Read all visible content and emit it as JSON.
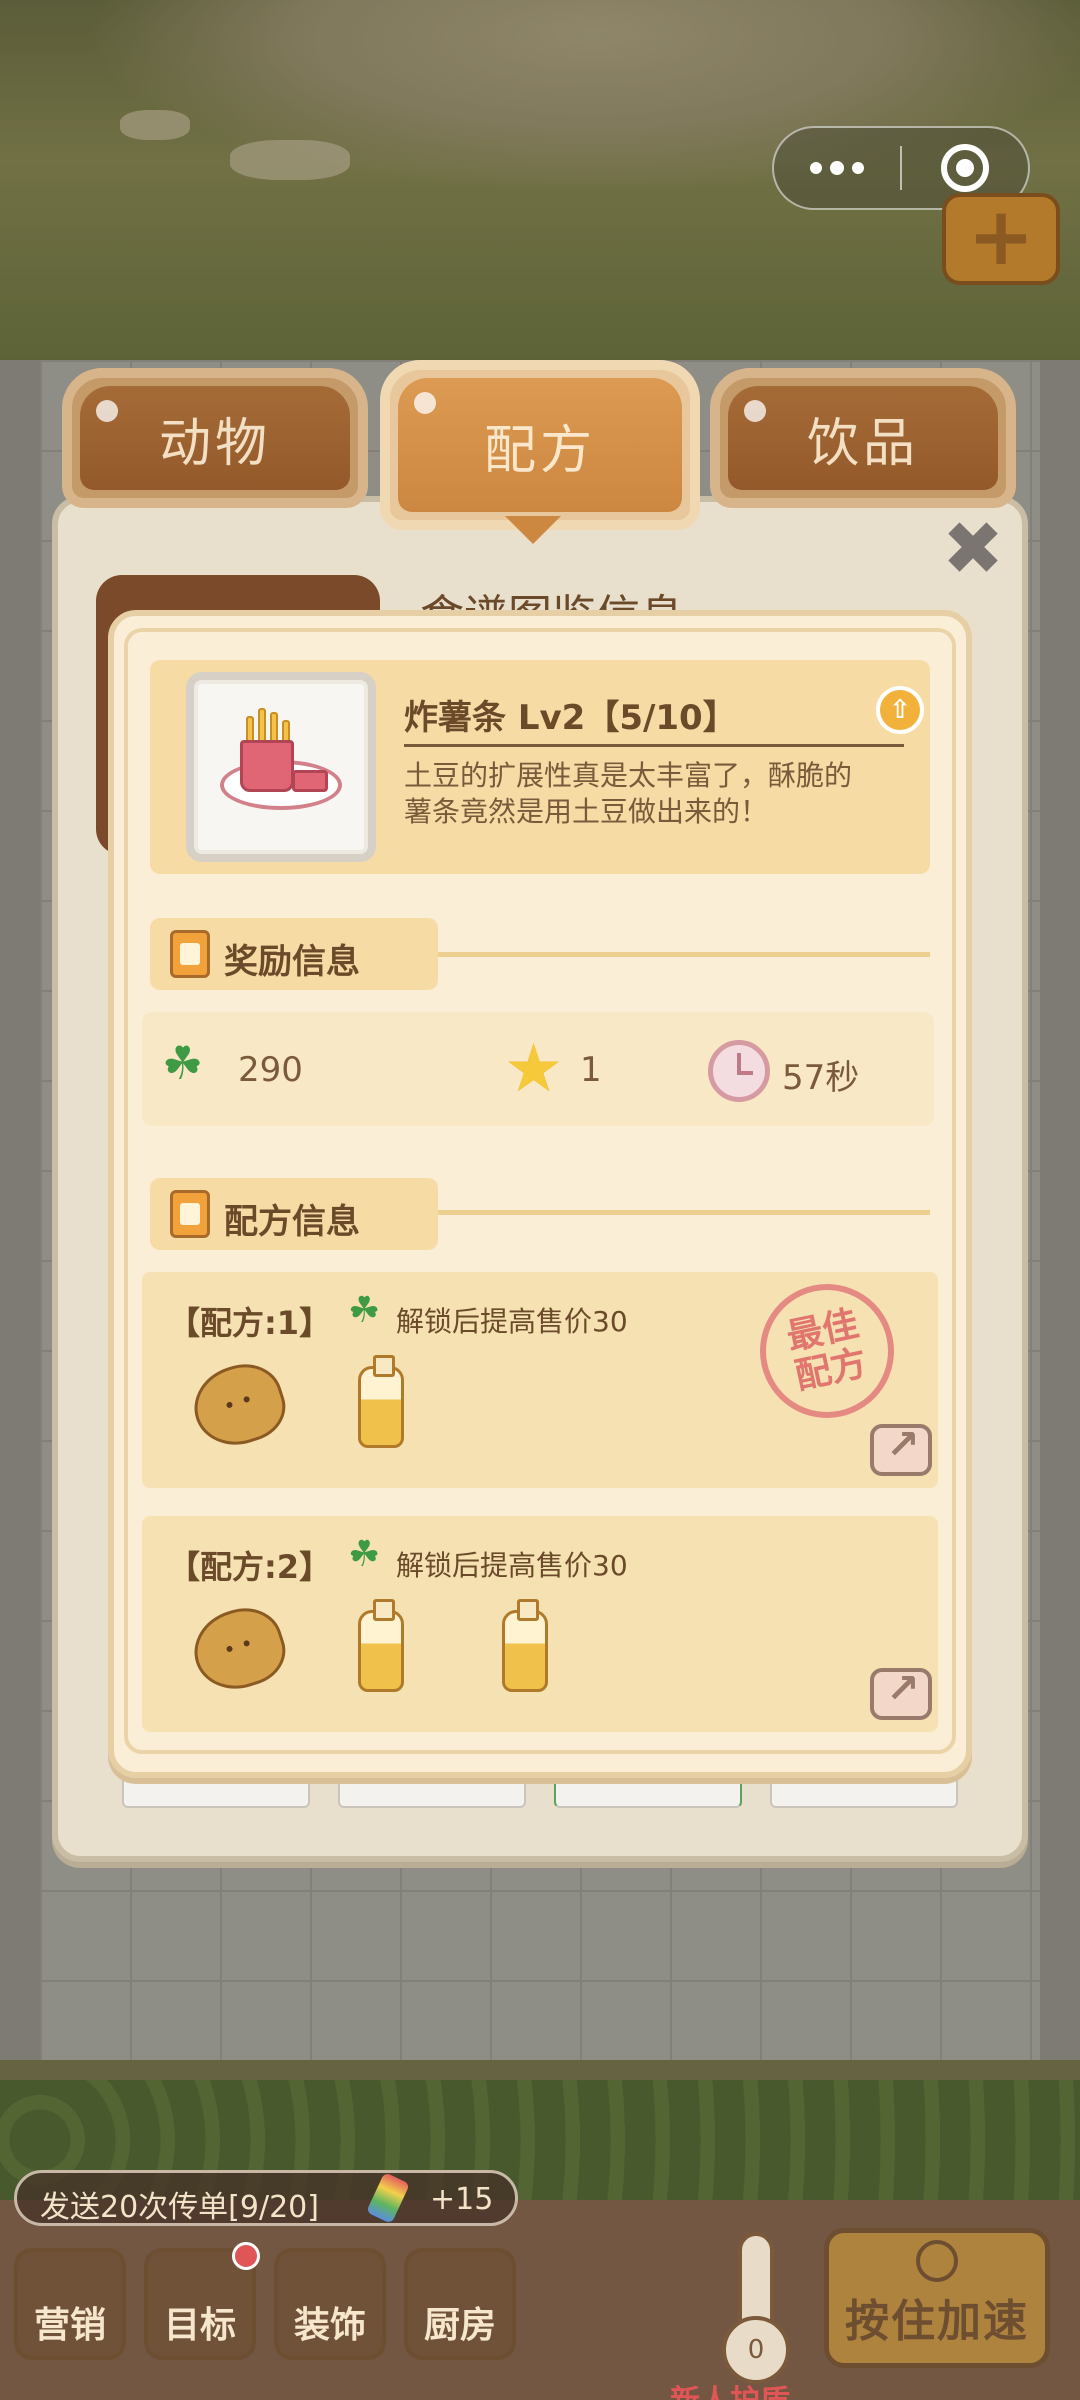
{
  "tabs": [
    {
      "label": "动物"
    },
    {
      "label": "配方"
    },
    {
      "label": "饮品"
    }
  ],
  "panel": {
    "background_title": "食谱图鉴信息"
  },
  "item": {
    "name": "炸薯条 Lv2【5/10】",
    "description": "土豆的扩展性真是太丰富了，酥脆的薯条竟然是用土豆做出来的！",
    "image_icon": "fries-icon",
    "upgrade_icon": "arrow-up-icon"
  },
  "rewards": {
    "title": "奖励信息",
    "clover_value": "290",
    "star_value": "1",
    "time_value": "57秒"
  },
  "recipes": {
    "title": "配方信息",
    "list": [
      {
        "label": "【配方:1】",
        "note": "解锁后提高售价30",
        "best": true,
        "ingredients": [
          "potato-icon",
          "bottle-icon"
        ]
      },
      {
        "label": "【配方:2】",
        "note": "解锁后提高售价30",
        "best": false,
        "ingredients": [
          "potato-icon",
          "bottle-icon",
          "bottle-icon"
        ]
      }
    ],
    "best_stamp": [
      "最佳",
      "配方"
    ]
  },
  "hud": {
    "quest_text": "发送20次传单[9/20]",
    "quest_reward": "+15",
    "buttons": [
      "营销",
      "目标",
      "装饰",
      "厨房"
    ],
    "speed_button": "按住加速",
    "therm_value": "0",
    "newbie": "新人护盾"
  },
  "colors": {
    "panel_bg": "#e8dfcd",
    "card_bg": "#fbeed7",
    "accent_brown": "#94592a",
    "accent_orange": "#cc8740",
    "clover_green": "#3f9a44",
    "star_yellow": "#f6c93a",
    "stamp_red": "#e0766e"
  }
}
